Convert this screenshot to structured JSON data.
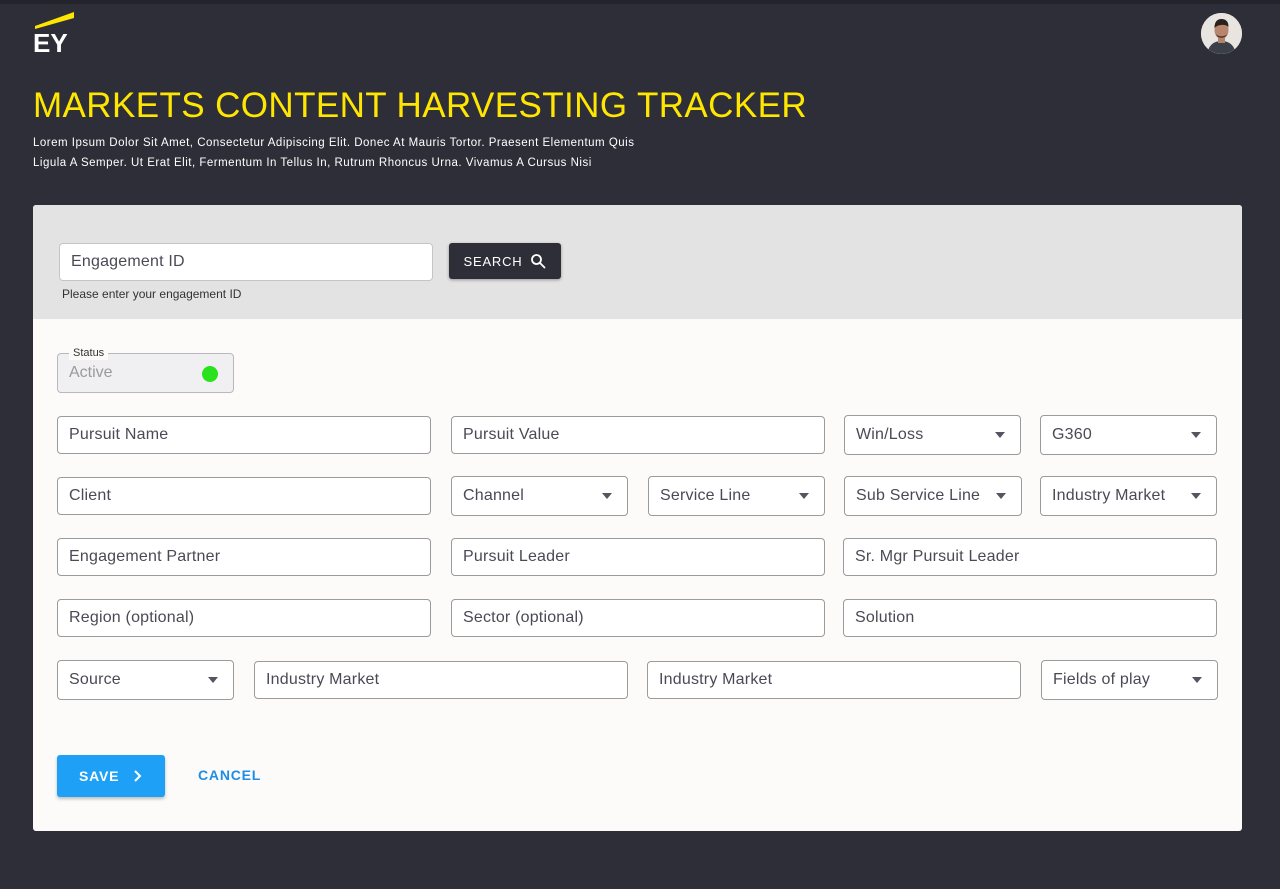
{
  "header": {
    "title": "MARKETS CONTENT HARVESTING TRACKER",
    "subtitle_line1": "Lorem Ipsum Dolor Sit Amet, Consectetur Adipiscing Elit. Donec At Mauris Tortor. Praesent Elementum Quis",
    "subtitle_line2": "Ligula A Semper. Ut Erat Elit, Fermentum In Tellus In, Rutrum Rhoncus Urna. Vivamus A Cursus Nisi",
    "logo_text": "EY",
    "brand_color": "#ffe600"
  },
  "search": {
    "placeholder": "Engagement ID",
    "helper": "Please enter your engagement ID",
    "button_label": "SEARCH",
    "button_icon": "search-icon"
  },
  "status": {
    "legend": "Status",
    "value": "Active",
    "indicator_color": "#2ae11e"
  },
  "form": {
    "pursuit_name": "Pursuit Name",
    "pursuit_value": "Pursuit Value",
    "win_loss": "Win/Loss",
    "g360": "G360",
    "client": "Client",
    "channel": "Channel",
    "service_line": "Service Line",
    "sub_service_line": "Sub Service Line",
    "industry_market": "Industry Market",
    "engagement_partner": "Engagement Partner",
    "pursuit_leader": "Pursuit Leader",
    "sr_mgr_pursuit_leader": "Sr. Mgr Pursuit Leader",
    "region": "Region (optional)",
    "sector": "Sector (optional)",
    "solution": "Solution",
    "source": "Source",
    "industry_market_2": "Industry Market",
    "industry_market_3": "Industry Market",
    "fields_of_play": "Fields of play"
  },
  "actions": {
    "save_label": "SAVE",
    "cancel_label": "CANCEL",
    "accent": "#1ea0f7"
  }
}
